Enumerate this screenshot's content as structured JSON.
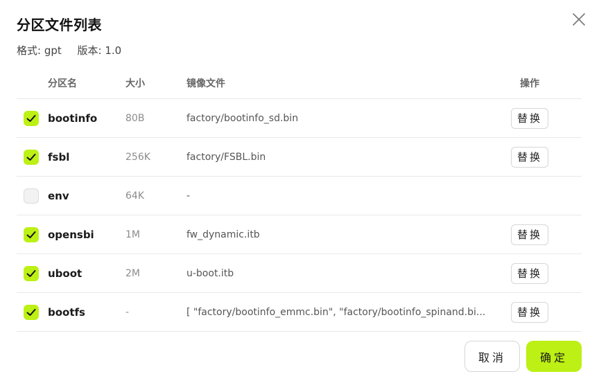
{
  "dialog": {
    "title": "分区文件列表",
    "format_text": "格式: gpt",
    "version_text": "版本: 1.0"
  },
  "table": {
    "headers": {
      "name": "分区名",
      "size": "大小",
      "file": "镜像文件",
      "op": "操作"
    },
    "rows": [
      {
        "checked": true,
        "name": "bootinfo",
        "size": "80B",
        "file": "factory/bootinfo_sd.bin",
        "op": "替换"
      },
      {
        "checked": true,
        "name": "fsbl",
        "size": "256K",
        "file": "factory/FSBL.bin",
        "op": "替换"
      },
      {
        "checked": false,
        "name": "env",
        "size": "64K",
        "file": "-",
        "op": ""
      },
      {
        "checked": true,
        "name": "opensbi",
        "size": "1M",
        "file": "fw_dynamic.itb",
        "op": "替换"
      },
      {
        "checked": true,
        "name": "uboot",
        "size": "2M",
        "file": "u-boot.itb",
        "op": "替换"
      },
      {
        "checked": true,
        "name": "bootfs",
        "size": "-",
        "file": "[ \"factory/bootinfo_emmc.bin\", \"factory/bootinfo_spinand.bi...",
        "op": "替换"
      }
    ]
  },
  "footer": {
    "cancel_label": "取消",
    "ok_label": "确定"
  },
  "colors": {
    "accent": "#bdf014"
  }
}
